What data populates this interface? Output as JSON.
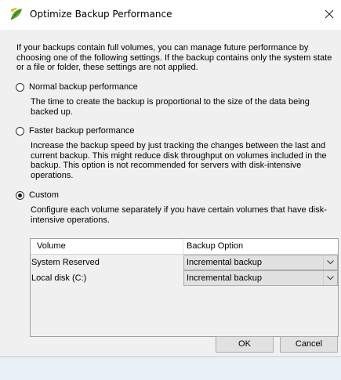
{
  "dialog": {
    "title": "Optimize Backup Performance",
    "intro": "If your backups contain full volumes, you can manage future performance by choosing one of the following settings. If the backup contains only the system state or a file or folder, these settings are not applied."
  },
  "options": [
    {
      "label": "Normal backup performance",
      "description": "The time to create the backup is proportional to the size of the data being backed up.",
      "selected": false
    },
    {
      "label": "Faster backup performance",
      "description": "Increase the backup speed by just tracking the changes between the last and current backup.  This might reduce disk throughput on volumes included in the backup. This option is not recommended for servers with disk-intensive operations.",
      "selected": false
    },
    {
      "label": "Custom",
      "description": "Configure each volume separately if you have certain volumes that have disk-intensive operations.",
      "selected": true
    }
  ],
  "table": {
    "headers": [
      "Volume",
      "Backup Option"
    ],
    "rows": [
      {
        "volume": "System Reserved",
        "option": "Incremental backup"
      },
      {
        "volume": "Local disk (C:)",
        "option": "Incremental backup"
      }
    ]
  },
  "buttons": {
    "ok": "OK",
    "cancel": "Cancel"
  },
  "icons": {
    "title": "backup-leaf-icon",
    "close": "close-icon",
    "dropdown": "chevron-down-icon"
  },
  "colors": {
    "accent": "#4a9a2a",
    "dialog_bg": "#f0f0f0",
    "desktop_bg": "#e8f0f8"
  }
}
